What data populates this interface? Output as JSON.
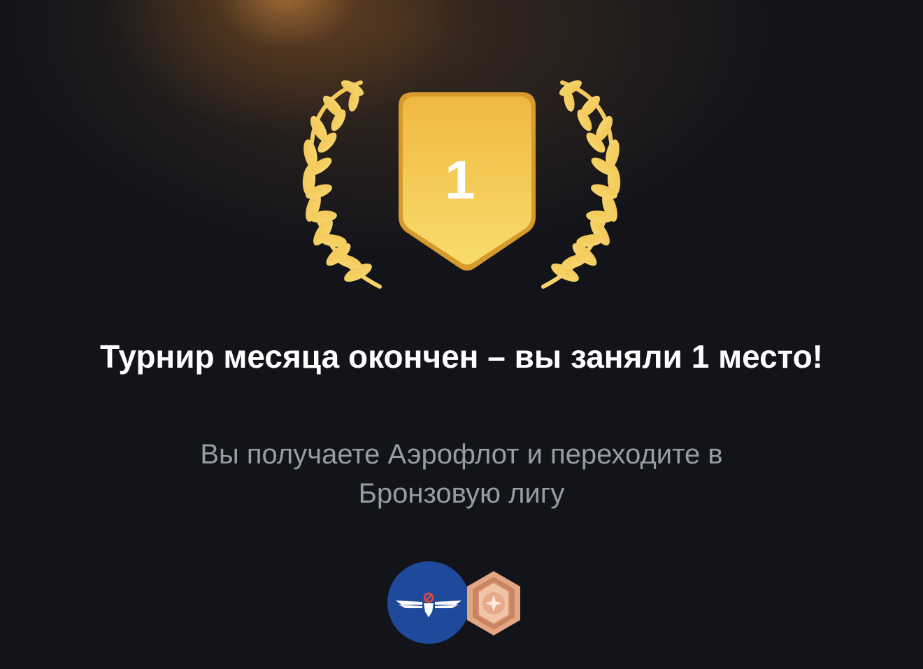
{
  "reward_card": {
    "place": "1",
    "title": "Турнир месяца окончен – вы заняли 1 место!",
    "subtitle": "Вы получаете Аэрофлот и переходите в Бронзовую лигу",
    "rewards": [
      {
        "icon": "aeroflot-logo-icon",
        "brand_color": "#1f4a9c"
      },
      {
        "icon": "bronze-league-badge-icon",
        "brand_color": "#d99a78"
      }
    ]
  },
  "colors": {
    "background": "#12141a",
    "gold": "#f2c14e",
    "gold_light": "#f8dc72",
    "title": "#ffffff",
    "subtitle": "#9a9ca3"
  }
}
